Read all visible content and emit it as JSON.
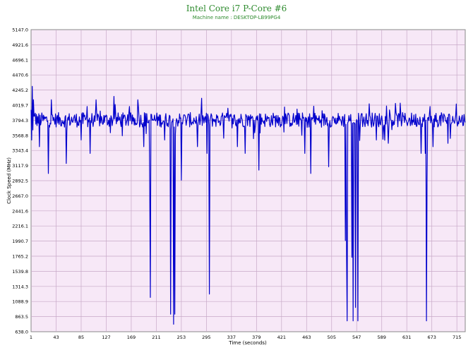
{
  "chart_data": {
    "type": "line",
    "title": "Intel Core i7 P-Core #6",
    "subtitle": "Machine name : DESKTOP-LB99PG4",
    "xlabel": "Time (seconds)",
    "ylabel": "Clock Speed (MHz)",
    "xlim": [
      1,
      729
    ],
    "ylim": [
      638.0,
      5147.0
    ],
    "x_ticks": [
      "1",
      "43",
      "85",
      "127",
      "169",
      "211",
      "253",
      "295",
      "337",
      "379",
      "421",
      "463",
      "505",
      "547",
      "589",
      "631",
      "673",
      "715"
    ],
    "y_ticks": [
      "5147.0",
      "4921.6",
      "4696.1",
      "4470.6",
      "4245.2",
      "4019.7",
      "3794.3",
      "3568.8",
      "3343.4",
      "3117.9",
      "2892.5",
      "2667.0",
      "2441.6",
      "2216.1",
      "1990.7",
      "1765.2",
      "1539.8",
      "1314.3",
      "1088.9",
      "863.5",
      "638.0"
    ],
    "grid": true,
    "series": [
      {
        "name": "",
        "color": "#0000cc",
        "baseline": 3800,
        "noise": 110,
        "early": [
          [
            1,
            3950
          ],
          [
            2,
            3500
          ],
          [
            3,
            4300
          ],
          [
            4,
            3650
          ],
          [
            5,
            4100
          ],
          [
            8,
            3900
          ]
        ],
        "peaks": [
          [
            35,
            4100
          ],
          [
            95,
            4000
          ],
          [
            110,
            4100
          ],
          [
            140,
            4150
          ],
          [
            180,
            4100
          ],
          [
            200,
            4150
          ],
          [
            460,
            4100
          ],
          [
            530,
            4050
          ],
          [
            620,
            4050
          ],
          [
            670,
            4000
          ]
        ],
        "dips": [
          [
            15,
            3400
          ],
          [
            30,
            3000
          ],
          [
            60,
            3150
          ],
          [
            85,
            3500
          ],
          [
            100,
            3300
          ],
          [
            190,
            3400
          ],
          [
            200,
            2800
          ],
          [
            201,
            1150
          ],
          [
            225,
            3500
          ],
          [
            235,
            900
          ],
          [
            240,
            750
          ],
          [
            242,
            900
          ],
          [
            253,
            2900
          ],
          [
            280,
            3400
          ],
          [
            296,
            3300
          ],
          [
            300,
            1200
          ],
          [
            347,
            3400
          ],
          [
            360,
            3300
          ],
          [
            383,
            3050
          ],
          [
            460,
            3300
          ],
          [
            470,
            3000
          ],
          [
            500,
            3100
          ],
          [
            528,
            2000
          ],
          [
            530,
            1800
          ],
          [
            531,
            800
          ],
          [
            539,
            1750
          ],
          [
            541,
            800
          ],
          [
            545,
            1000
          ],
          [
            549,
            800
          ],
          [
            580,
            3500
          ],
          [
            600,
            3450
          ],
          [
            655,
            3300
          ],
          [
            662,
            3300
          ],
          [
            664,
            800
          ],
          [
            665,
            2900
          ],
          [
            675,
            3400
          ],
          [
            700,
            3450
          ]
        ]
      }
    ]
  }
}
